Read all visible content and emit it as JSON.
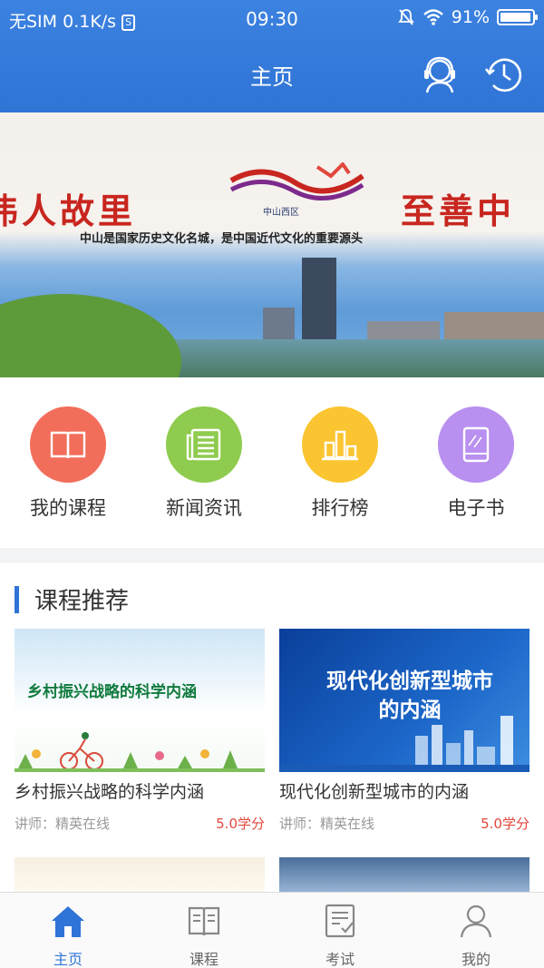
{
  "status_bar": {
    "carrier": "无SIM",
    "speed": "0.1K/s",
    "time": "09:30",
    "battery": "91%",
    "battery_level": 0.91
  },
  "nav": {
    "title": "主页",
    "right_icons": [
      "customer-service-icon",
      "history-clock-icon"
    ]
  },
  "banner": {
    "slogan_left": "伟人故里",
    "slogan_right": "至善中",
    "subtitle": "中山是国家历史文化名城，是中国近代文化的重要源头",
    "logo_text": "中山西区"
  },
  "quick_menu": [
    {
      "label": "我的课程",
      "icon": "book-icon",
      "color": "#f26e5b"
    },
    {
      "label": "新闻资讯",
      "icon": "news-icon",
      "color": "#8fcb4e"
    },
    {
      "label": "排行榜",
      "icon": "ranking-icon",
      "color": "#fbc531"
    },
    {
      "label": "电子书",
      "icon": "tablet-icon",
      "color": "#b98ff0"
    }
  ],
  "recommend": {
    "title": "课程推荐",
    "courses": [
      {
        "image_text": "乡村振兴战略的科学内涵",
        "title": "乡村振兴战略的科学内涵",
        "lecturer": "讲师：精英在线",
        "credit": "5.0学分"
      },
      {
        "image_text": "现代化创新型城市的内涵",
        "title": "现代化创新型城市的内涵",
        "lecturer": "讲师：精英在线",
        "credit": "5.0学分"
      }
    ]
  },
  "tabbar": [
    {
      "label": "主页",
      "icon": "home-icon",
      "active": true
    },
    {
      "label": "课程",
      "icon": "course-book-icon",
      "active": false
    },
    {
      "label": "考试",
      "icon": "exam-icon",
      "active": false
    },
    {
      "label": "我的",
      "icon": "profile-icon",
      "active": false
    }
  ],
  "colors": {
    "primary": "#2f74d6",
    "credit_red": "#e2463c"
  }
}
